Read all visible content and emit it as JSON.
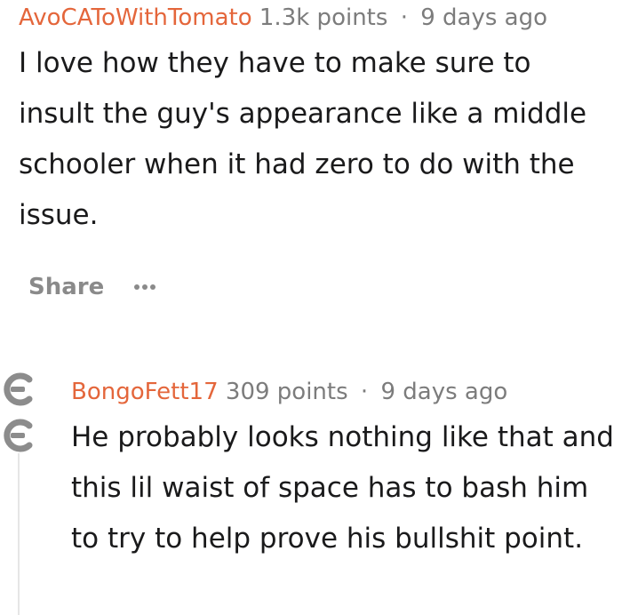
{
  "comments": [
    {
      "username": "AvoCAToWithTomato",
      "points": "1.3k points",
      "separator": "·",
      "age": "9 days ago",
      "body": "I love how they have to make sure to insult the guy's appearance like a middle schooler when it had zero to do with the issue.",
      "actions": {
        "share_label": "Share",
        "more_label": "•••"
      }
    },
    {
      "username": "BongoFett17",
      "points": "309 points",
      "separator": "·",
      "age": "9 days ago",
      "body": "He probably looks nothing like that and this lil waist of space has to bash him to try to help prove his bullshit point."
    }
  ],
  "colors": {
    "username": "#e4663b",
    "meta": "#7c7c7c",
    "body": "#1a1a1b",
    "action": "#8a8a8a",
    "collapse_icon": "#8c8c8c",
    "thread_line": "#e6e6e6"
  },
  "icons": {
    "collapse": "collapse-thread-icon"
  }
}
